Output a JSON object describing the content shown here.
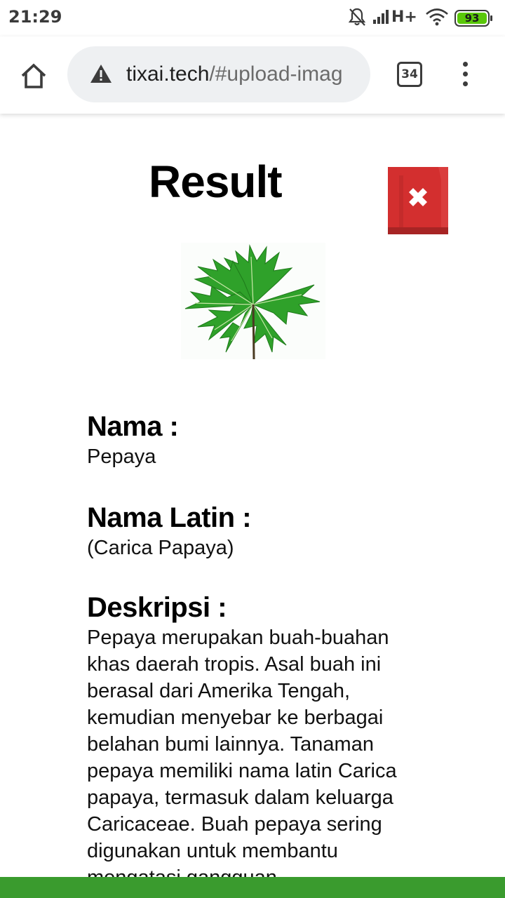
{
  "status_bar": {
    "time": "21:29",
    "network_type": "H+",
    "battery_level": "93",
    "icons": [
      "bell-off-icon",
      "signal-icon",
      "wifi-icon",
      "battery-icon"
    ],
    "battery_color": "#5ac80a"
  },
  "browser": {
    "url_host": "tixai.tech",
    "url_path": "/#upload-imag",
    "tab_count": "34",
    "icons": [
      "home-icon",
      "warning-icon",
      "tabs-icon",
      "more-vert-icon"
    ]
  },
  "result": {
    "title": "Result",
    "close_icon": "close-icon",
    "close_color": "#d32f2f",
    "image_alt": "papaya-leaf-image",
    "nama_label": "Nama :",
    "nama_value": "Pepaya",
    "latin_label": "Nama Latin :",
    "latin_value": "(Carica Papaya)",
    "desc_label": "Deskripsi :",
    "desc_value": "Pepaya merupakan buah-buahan khas daerah tropis. Asal buah ini berasal dari Amerika Tengah, kemudian menyebar ke berbagai belahan bumi lainnya. Tanaman pepaya memiliki nama latin Carica papaya, termasuk dalam keluarga Caricaceae. Buah pepaya sering digunakan untuk membantu mengatasi gangguan"
  },
  "colors": {
    "bottom_bar": "#3a9b2e"
  }
}
